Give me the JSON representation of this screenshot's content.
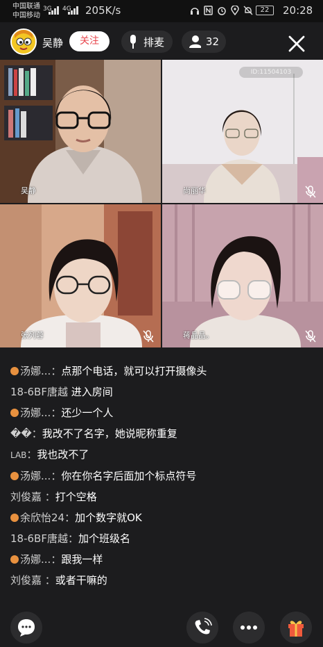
{
  "status_bar": {
    "carrier_1": "中国联通",
    "carrier_2": "中国移动",
    "net_1": "3G",
    "net_2": "4G",
    "speed": "205K/s",
    "battery": "22",
    "time": "20:28"
  },
  "header": {
    "host_name": "吴静",
    "follow_label": "关注",
    "queue_label": "排麦",
    "viewer_count": "32"
  },
  "video_tiles": [
    {
      "name": "吴静",
      "muted": false
    },
    {
      "name": "尚丽华",
      "muted": true,
      "room_id": "ID:11504103"
    },
    {
      "name": "张列蓉",
      "muted": true
    },
    {
      "name": "蒋晶晶。",
      "muted": true
    }
  ],
  "chat": [
    {
      "user": "汤娜...",
      "sep": "：",
      "text": "点那个电话，就可以打开摄像头",
      "badge": true,
      "wrap": true
    },
    {
      "user": "18-6BF唐越",
      "sep": " ",
      "text": "进入房间",
      "badge": false
    },
    {
      "user": "汤娜...",
      "sep": "：",
      "text": "还少一个人",
      "badge": true
    },
    {
      "user": "��",
      "sep": "：",
      "text": "我改不了名字，她说昵称重复",
      "badge": false
    },
    {
      "user": "LAB",
      "sep": "：",
      "text": "我也改不了",
      "badge": false,
      "small": true
    },
    {
      "user": "汤娜...",
      "sep": "：",
      "text": "你在你名字后面加个标点符号",
      "badge": true
    },
    {
      "user": "刘俊嘉 ",
      "sep": "：",
      "text": "打个空格",
      "badge": false
    },
    {
      "user": "余欣怡24",
      "sep": "：",
      "text": "加个数字就OK",
      "badge": true
    },
    {
      "user": "18-6BF唐越",
      "sep": "：",
      "text": "加个班级名",
      "badge": false
    },
    {
      "user": "汤娜...",
      "sep": "：",
      "text": "跟我一样",
      "badge": true
    },
    {
      "user": "刘俊嘉 ",
      "sep": "：",
      "text": "或者干嘛的",
      "badge": false
    }
  ],
  "colors": {
    "background": "#1c1c1e",
    "follow_text": "#e8484f",
    "gift": "#f05a3c"
  },
  "bottom_bar": [
    "chat-bubble-icon",
    "phone-call-icon",
    "more-icon",
    "gift-icon"
  ]
}
